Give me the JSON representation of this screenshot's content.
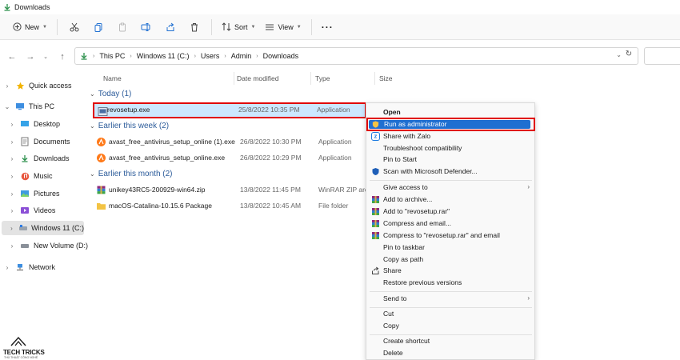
{
  "window": {
    "title": "Downloads"
  },
  "toolbar": {
    "new_label": "New",
    "sort_label": "Sort",
    "view_label": "View",
    "more_label": "···"
  },
  "address": {
    "crumbs": [
      "This PC",
      "Windows 11 (C:)",
      "Users",
      "Admin",
      "Downloads"
    ]
  },
  "sidebar": {
    "items": [
      {
        "label": "Quick access"
      },
      {
        "label": "This PC"
      },
      {
        "label": "Desktop"
      },
      {
        "label": "Documents"
      },
      {
        "label": "Downloads"
      },
      {
        "label": "Music"
      },
      {
        "label": "Pictures"
      },
      {
        "label": "Videos"
      },
      {
        "label": "Windows 11 (C:)"
      },
      {
        "label": "New Volume (D:)"
      },
      {
        "label": "Network"
      }
    ]
  },
  "columns": [
    "Name",
    "Date modified",
    "Type",
    "Size"
  ],
  "groups": [
    {
      "label": "Today (1)"
    },
    {
      "label": "Earlier this week (2)"
    },
    {
      "label": "Earlier this month (2)"
    }
  ],
  "files": [
    {
      "name": "revosetup.exe",
      "date": "25/8/2022 10:35 PM",
      "type": "Application"
    },
    {
      "name": "avast_free_antivirus_setup_online (1).exe",
      "date": "26/8/2022 10:30 PM",
      "type": "Application"
    },
    {
      "name": "avast_free_antivirus_setup_online.exe",
      "date": "26/8/2022 10:29 PM",
      "type": "Application"
    },
    {
      "name": "unikey43RC5-200929-win64.zip",
      "date": "13/8/2022 11:45 PM",
      "type": "WinRAR ZIP archi"
    },
    {
      "name": "macOS-Catalina-10.15.6 Package",
      "date": "13/8/2022 10:45 AM",
      "type": "File folder"
    }
  ],
  "context_menu": {
    "items": [
      "Open",
      "Run as administrator",
      "Share with Zalo",
      "Troubleshoot compatibility",
      "Pin to Start",
      "Scan with Microsoft Defender...",
      "Give access to",
      "Add to archive...",
      "Add to \"revosetup.rar\"",
      "Compress and email...",
      "Compress to \"revosetup.rar\" and email",
      "Pin to taskbar",
      "Copy as path",
      "Share",
      "Restore previous versions",
      "Send to",
      "Cut",
      "Copy",
      "Create shortcut",
      "Delete"
    ]
  },
  "watermark": {
    "text": "TECH TRICKS",
    "sub": "THỦ THUẬT CÔNG NGHỆ"
  },
  "colors": {
    "accent": "#1f6fd1",
    "highlight_outline": "#e00000",
    "group_text": "#2b5b9a",
    "selection": "#cce8ff"
  }
}
